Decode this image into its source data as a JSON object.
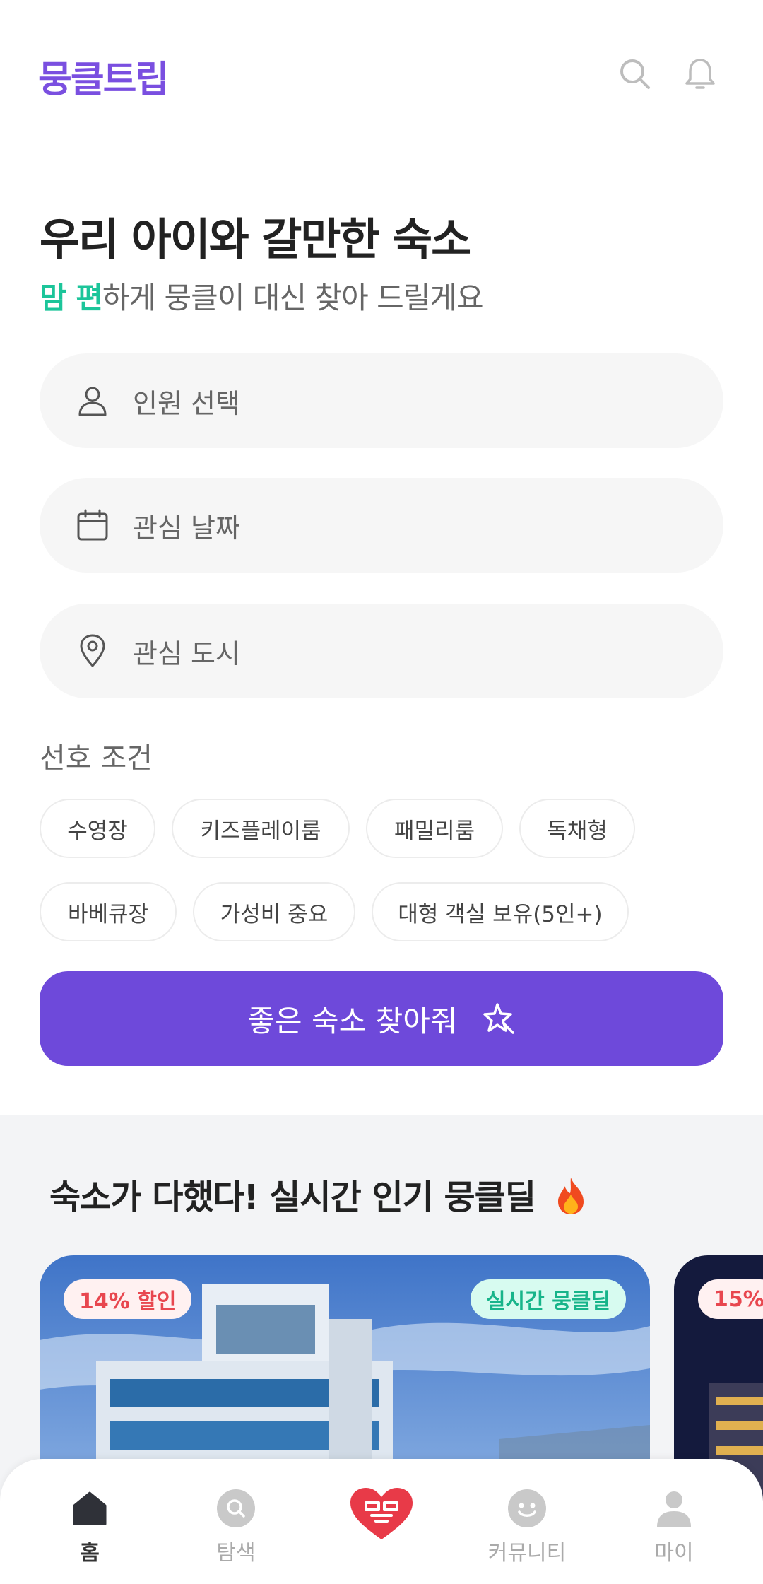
{
  "header": {
    "logo": "뭉클트립",
    "search_icon": "search-icon",
    "bell_icon": "bell-icon"
  },
  "hero": {
    "title": "우리 아이와 갈만한 숙소",
    "subtitle_accent": "맘 편",
    "subtitle_rest": "하게 뭉클이 대신 찾아 드릴게요"
  },
  "search": {
    "people_label": "인원 선택",
    "date_label": "관심 날짜",
    "city_label": "관심 도시"
  },
  "preferences": {
    "title": "선호 조건",
    "chips": [
      "수영장",
      "키즈플레이룸",
      "패밀리룸",
      "독채형",
      "바베큐장",
      "가성비 중요",
      "대형 객실 보유(5인+)"
    ]
  },
  "cta": {
    "label": "좋은 숙소 찾아줘"
  },
  "deals": {
    "title": "숙소가 다했다! 실시간 인기 뭉클딜",
    "cards": [
      {
        "discount": "14% 할인",
        "tag": "실시간 뭉클딜"
      },
      {
        "discount": "15%"
      }
    ]
  },
  "nav": {
    "items": [
      {
        "label": "홈",
        "icon": "home-icon",
        "active": true
      },
      {
        "label": "탐색",
        "icon": "explore-icon",
        "active": false
      },
      {
        "label": "",
        "icon": "mungkeul-heart-icon",
        "active": false
      },
      {
        "label": "커뮤니티",
        "icon": "community-icon",
        "active": false
      },
      {
        "label": "마이",
        "icon": "profile-icon",
        "active": false
      }
    ]
  },
  "colors": {
    "brand": "#6e49da",
    "logo": "#7a4fe0",
    "accent_green": "#1cc59a",
    "discount_red": "#e8474f"
  }
}
